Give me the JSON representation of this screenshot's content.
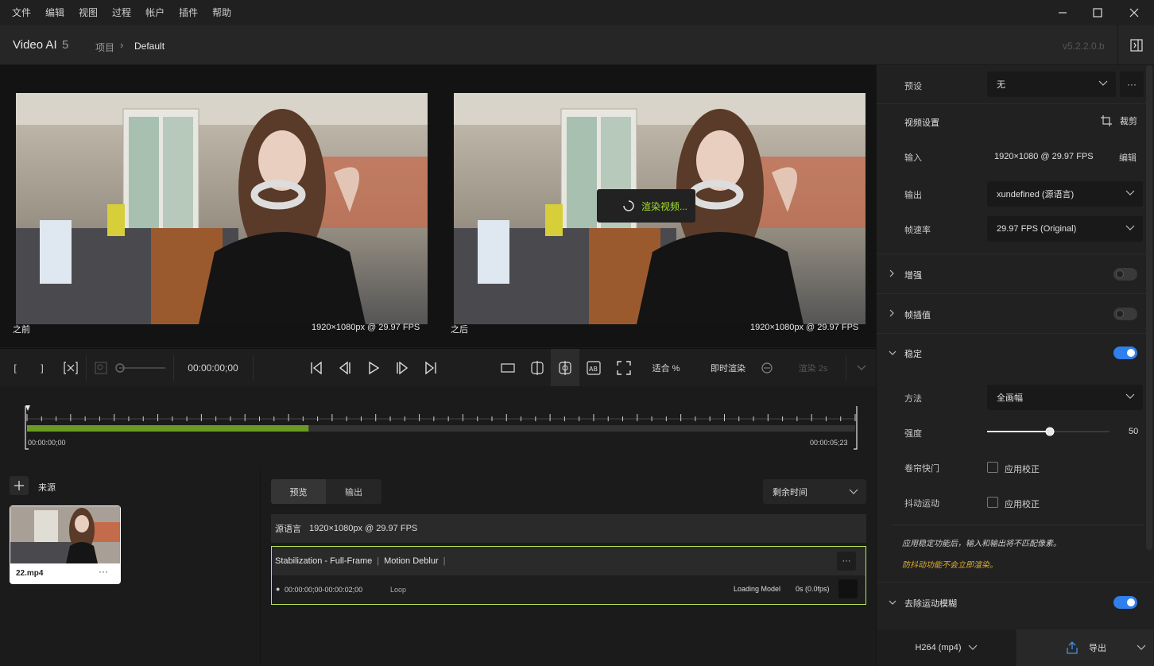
{
  "menu": [
    "文件",
    "编辑",
    "视图",
    "过程",
    "帐户",
    "插件",
    "帮助"
  ],
  "header": {
    "app_name": "Video AI",
    "app_version": "5",
    "breadcrumb_project": "项目",
    "breadcrumb_current": "Default",
    "version": "v5.2.2.0.b"
  },
  "preview": {
    "before_label": "之前",
    "before_info": "1920×1080px @ 29.97 FPS",
    "after_label": "之后",
    "after_info": "1920×1080px @ 29.97 FPS",
    "render_toast": "渲染视频..."
  },
  "controls": {
    "timecode": "00:00:00;00",
    "fit_label": "适合 %",
    "realtime_label": "即时渲染",
    "render_label": "渲染 2s"
  },
  "timeline": {
    "start": "00:00:00;00",
    "end": "00:00:05;23",
    "progress": 0.34
  },
  "sources": {
    "title": "来源",
    "file_name": "22.mp4"
  },
  "queue": {
    "tabs": [
      "预览",
      "输出"
    ],
    "sort_select": "剩余时间",
    "source_label": "源语言",
    "source_info": "1920×1080px @ 29.97 FPS",
    "job_title_1": "Stabilization - Full-Frame",
    "job_title_2": "Motion Deblur",
    "job_range": "00:00:00;00-00:00:02;00",
    "job_loop": "Loop",
    "job_status": "Loading Model",
    "job_fps": "0s (0.0fps)"
  },
  "sidebar": {
    "preset_label": "预设",
    "preset_value": "无",
    "video_settings": "视频设置",
    "crop_label": "裁剪",
    "input_label": "输入",
    "input_value": "1920×1080 @ 29.97 FPS",
    "edit_label": "编辑",
    "output_label": "输出",
    "output_value": "xundefined (源语言)",
    "fps_label": "帧速率",
    "fps_value": "29.97 FPS (Original)",
    "enhance": "增强",
    "interp": "帧插值",
    "stabilize": "稳定",
    "method_label": "方法",
    "method_value": "全画幅",
    "strength_label": "强度",
    "strength_value": "50",
    "rolling_label": "卷帘快门",
    "rolling_check": "应用校正",
    "jitter_label": "抖动运动",
    "jitter_check": "应用校正",
    "note1": "应用稳定功能后，输入和输出将不匹配像素。",
    "note2": "防抖动功能不会立即渲染。",
    "deblur": "去除运动模糊",
    "format": "H264 (mp4)",
    "export": "导出",
    "enhance_on": false,
    "interp_on": false,
    "stabilize_on": true,
    "deblur_on": true,
    "strength_fraction": 0.5
  },
  "colors": {
    "accent": "#2f80ed",
    "green": "#7cb342",
    "highlight": "#b5e655",
    "note": "#e0b030"
  }
}
